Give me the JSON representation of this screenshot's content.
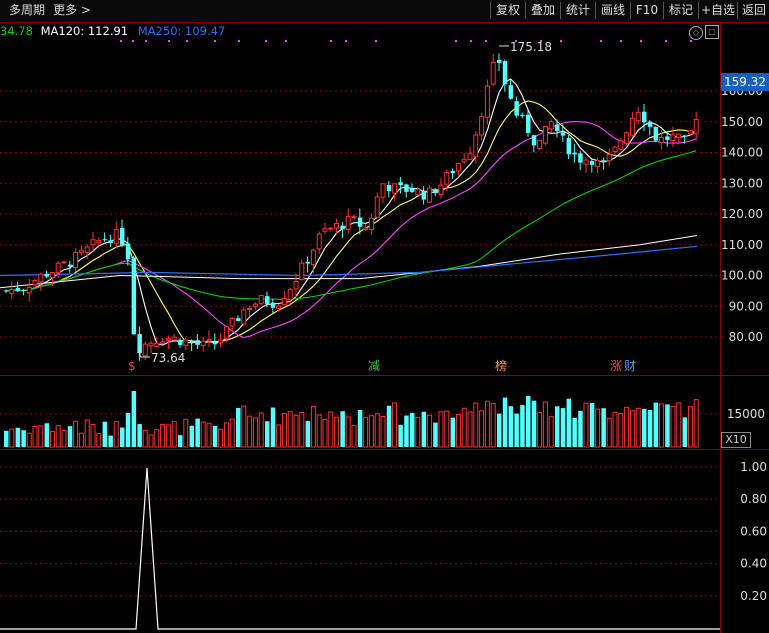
{
  "toolbar": {
    "period": "多周期",
    "more": "更多 >",
    "buttons": [
      "复权",
      "叠加",
      "统计",
      "画线",
      "F10",
      "标记",
      "+自选",
      "返回"
    ]
  },
  "ma_legend": [
    {
      "text": "34.78",
      "color": "#00d000"
    },
    {
      "text": "MA120: 112.91",
      "color": "#ffffff"
    },
    {
      "text": "MA250: 109.47",
      "color": "#2f6fff"
    }
  ],
  "price_axis": [
    "160.00",
    "150.00",
    "140.00",
    "130.00",
    "120.00",
    "110.00",
    "100.00",
    "90.00",
    "80.00"
  ],
  "price_badge": "159.32",
  "annotations": {
    "high": "175.18",
    "low": "73.64"
  },
  "events": [
    {
      "text": "$",
      "color": "#ff4040"
    },
    {
      "text": "减",
      "color": "#33cc33"
    },
    {
      "text": "榜",
      "color": "#ff9933"
    },
    {
      "text": "涨",
      "color": "#ff4040"
    },
    {
      "text": "财",
      "color": "#4f9dff"
    }
  ],
  "volume_axis": {
    "label": "15000",
    "unit": "X10"
  },
  "indicator_axis": [
    "1.00",
    "0.80",
    "0.60",
    "0.40",
    "0.20"
  ],
  "colors": {
    "up": "#ff3030",
    "down": "#54ffff",
    "grid": "#8b0000"
  }
}
